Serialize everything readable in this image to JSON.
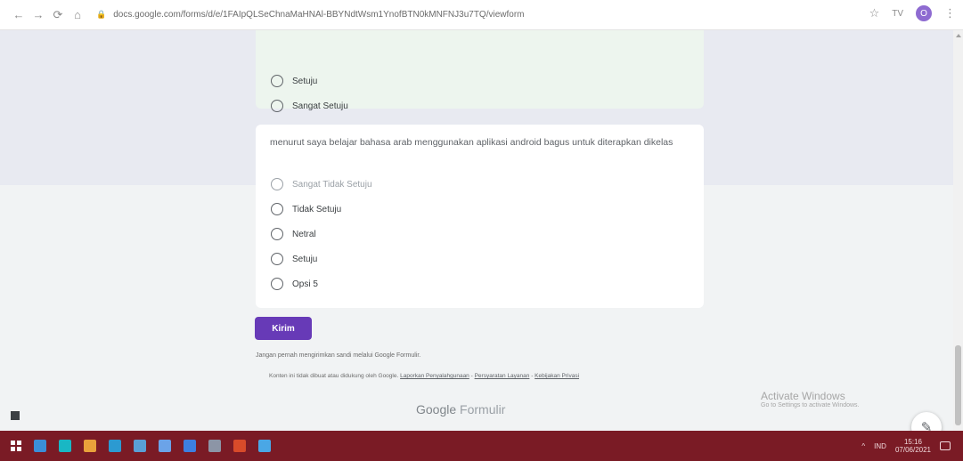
{
  "browser": {
    "url": "docs.google.com/forms/d/e/1FAIpQLSeChnaMaHNAl-BBYNdtWsm1YnofBTN0kMNFNJ3u7TQ/viewform",
    "nav": {
      "back": "←",
      "forward": "→",
      "reload": "⟳",
      "home": "⌂"
    },
    "lock_icon": "🔒",
    "star_icon": "☆",
    "extension_label": "TV",
    "profile_initial": "O",
    "menu_icon": "⋮"
  },
  "form": {
    "card_a": {
      "options": [
        {
          "label": "Setuju"
        },
        {
          "label": "Sangat Setuju"
        }
      ]
    },
    "card_b": {
      "question": "menurut saya belajar bahasa arab menggunakan aplikasi android bagus untuk diterapkan dikelas",
      "options": [
        {
          "label": "Sangat Tidak Setuju"
        },
        {
          "label": "Tidak Setuju"
        },
        {
          "label": "Netral"
        },
        {
          "label": "Setuju"
        },
        {
          "label": "Opsi 5"
        }
      ]
    },
    "submit_label": "Kirim",
    "never_submit": "Jangan pernah mengirimkan sandi melalui Google Formulir.",
    "disclaimer_text": "Konten ini tidak dibuat atau didukung oleh Google.",
    "links": {
      "report": "Laporkan Penyalahgunaan",
      "terms": "Persyaratan Layanan",
      "privacy": "Kebijakan Privasi"
    },
    "brand_google": "Google",
    "brand_forms": "Formulir"
  },
  "watermark": {
    "title": "Activate Windows",
    "subtitle": "Go to Settings to activate Windows."
  },
  "fab_icon": "✎",
  "taskbar": {
    "icons": [
      {
        "name": "file-explorer",
        "color": "#3b8ed8"
      },
      {
        "name": "media-player",
        "color": "#19b7c4"
      },
      {
        "name": "chrome",
        "color": "#e9a13b"
      },
      {
        "name": "photos",
        "color": "#2c9ad1"
      },
      {
        "name": "store",
        "color": "#5a9fd6"
      },
      {
        "name": "edge",
        "color": "#6ba3e8"
      },
      {
        "name": "mail",
        "color": "#3d7fe0"
      },
      {
        "name": "steam",
        "color": "#8c95a6"
      },
      {
        "name": "office",
        "color": "#d84b2a"
      },
      {
        "name": "internet-explorer",
        "color": "#4aa7e5"
      }
    ],
    "tray_arrow": "^",
    "language": "IND",
    "time": "15:16",
    "date": "07/06/2021"
  }
}
